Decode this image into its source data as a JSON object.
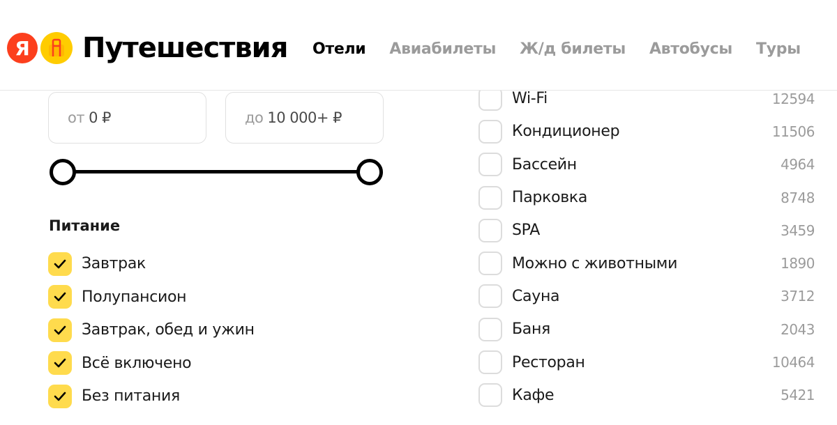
{
  "header": {
    "logo_ya": "Я",
    "brand": "Путешествия",
    "nav": [
      {
        "label": "Отели",
        "active": true
      },
      {
        "label": "Авиабилеты",
        "active": false
      },
      {
        "label": "Ж/д билеты",
        "active": false
      },
      {
        "label": "Автобусы",
        "active": false
      },
      {
        "label": "Туры",
        "active": false
      }
    ]
  },
  "price": {
    "from_prefix": "от",
    "from_value": "0 ₽",
    "to_prefix": "до",
    "to_value": "10 000+ ₽",
    "range_min": 0,
    "range_max": 1
  },
  "meals": {
    "title": "Питание",
    "items": [
      {
        "label": "Завтрак",
        "checked": true
      },
      {
        "label": "Полупансион",
        "checked": true
      },
      {
        "label": "Завтрак, обед и ужин",
        "checked": true
      },
      {
        "label": "Всё включено",
        "checked": true
      },
      {
        "label": "Без питания",
        "checked": true
      }
    ]
  },
  "amenities": {
    "items": [
      {
        "label": "Wi-Fi",
        "count": "12594",
        "checked": false
      },
      {
        "label": "Кондиционер",
        "count": "11506",
        "checked": false
      },
      {
        "label": "Бассейн",
        "count": "4964",
        "checked": false
      },
      {
        "label": "Парковка",
        "count": "8748",
        "checked": false
      },
      {
        "label": "SPA",
        "count": "3459",
        "checked": false
      },
      {
        "label": "Можно с животными",
        "count": "1890",
        "checked": false
      },
      {
        "label": "Сауна",
        "count": "3712",
        "checked": false
      },
      {
        "label": "Баня",
        "count": "2043",
        "checked": false
      },
      {
        "label": "Ресторан",
        "count": "10464",
        "checked": false
      },
      {
        "label": "Кафе",
        "count": "5421",
        "checked": false
      }
    ]
  },
  "colors": {
    "accent": "#ffdb4d",
    "logo_red": "#fc3f1d",
    "logo_yellow": "#ffcc00",
    "muted_text": "#9b9b9b"
  }
}
